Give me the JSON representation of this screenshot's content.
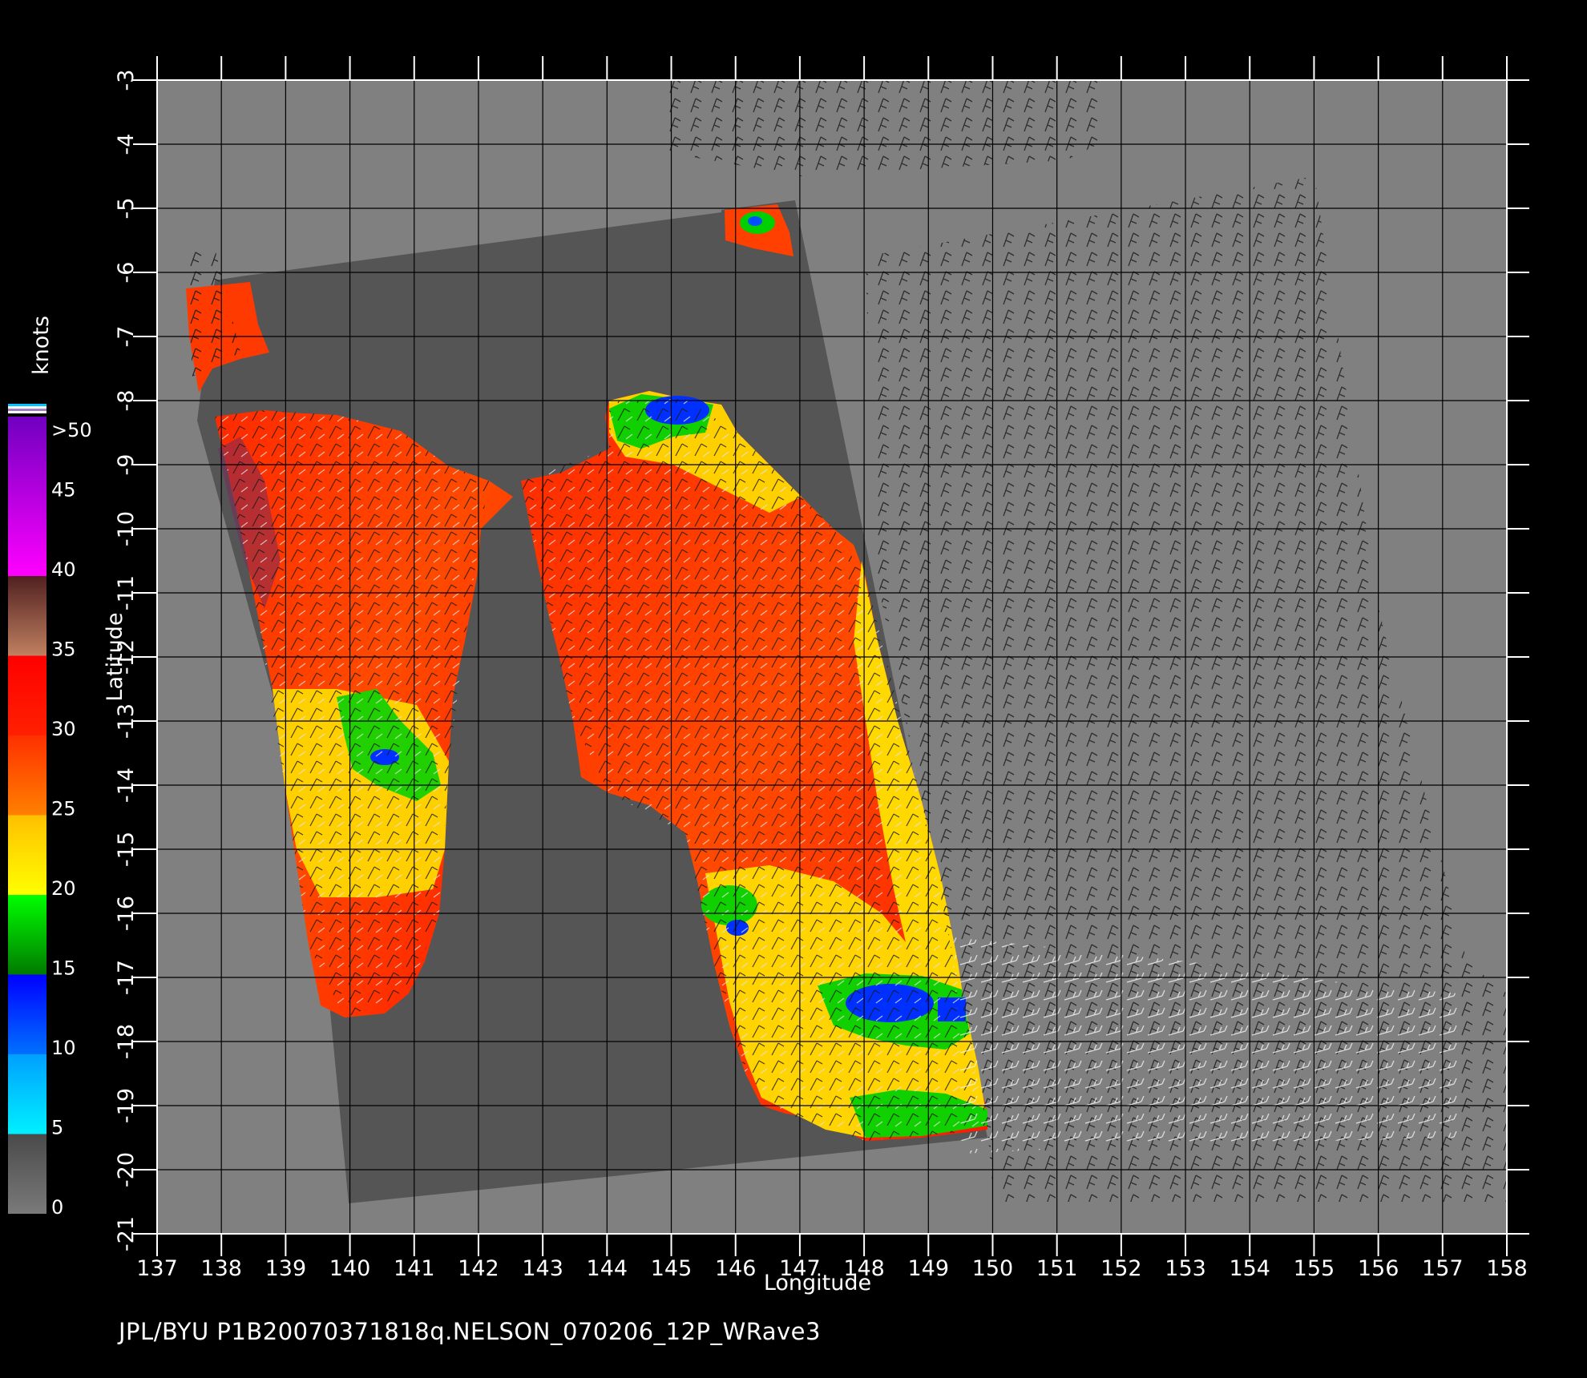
{
  "map": {
    "lon_range": [
      137,
      158
    ],
    "lat_range": [
      -3,
      -21
    ],
    "lon_ticks": [
      137,
      138,
      139,
      140,
      141,
      142,
      143,
      144,
      145,
      146,
      147,
      148,
      149,
      150,
      151,
      152,
      153,
      154,
      155,
      156,
      157,
      158
    ],
    "lat_ticks": [
      -3,
      -4,
      -5,
      -6,
      -7,
      -8,
      -9,
      -10,
      -11,
      -12,
      -13,
      -14,
      -15,
      -16,
      -17,
      -18,
      -19,
      -20,
      -21
    ],
    "xlabel": "Longitude",
    "ylabel": "Latitude",
    "grid": true,
    "background_color": "#808080",
    "land_mask_color": "#555555"
  },
  "colorbar": {
    "title": "knots",
    "labels": [
      ">50",
      "45",
      "40",
      "35",
      "30",
      "25",
      "20",
      "15",
      "10",
      "5",
      "0"
    ],
    "bands": [
      {
        "from": 0,
        "to": 5,
        "color_top": "#4a4a4a",
        "color_bottom": "#7a7a7a"
      },
      {
        "from": 5,
        "to": 10,
        "color_top": "#00a0ff",
        "color_bottom": "#00f0ff"
      },
      {
        "from": 10,
        "to": 15,
        "color_top": "#0000ff",
        "color_bottom": "#0070ff"
      },
      {
        "from": 15,
        "to": 20,
        "color_top": "#00ff00",
        "color_bottom": "#007a00"
      },
      {
        "from": 20,
        "to": 25,
        "color_top": "#ffc000",
        "color_bottom": "#ffff00"
      },
      {
        "from": 25,
        "to": 30,
        "color_top": "#ff3000",
        "color_bottom": "#ff8000"
      },
      {
        "from": 30,
        "to": 35,
        "color_top": "#ff0000",
        "color_bottom": "#ff2000"
      },
      {
        "from": 35,
        "to": 40,
        "color_top": "#502020",
        "color_bottom": "#c08060"
      },
      {
        "from": 40,
        "to": 50,
        "color_top": "#7000c0",
        "color_bottom": "#ff00ff"
      }
    ]
  },
  "credit": "JPL/BYU  P1B20070371818q.NELSON_070206_12P_WRave3"
}
